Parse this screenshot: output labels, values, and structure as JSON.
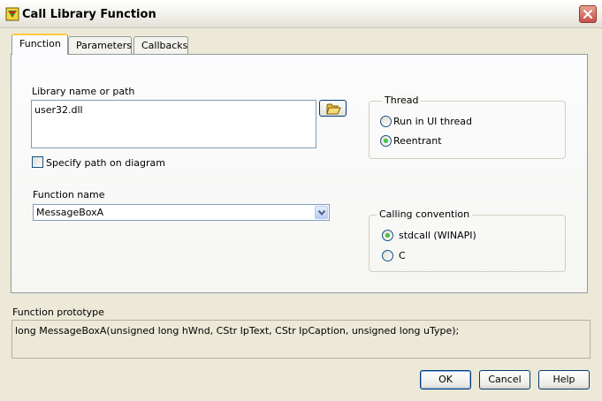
{
  "window": {
    "title": "Call Library Function"
  },
  "tabs": [
    {
      "label": "Function",
      "active": true
    },
    {
      "label": "Parameters",
      "active": false
    },
    {
      "label": "Callbacks",
      "active": false
    }
  ],
  "library": {
    "label": "Library name or path",
    "value": "user32.dll",
    "specify_path_label": "Specify path on diagram",
    "specify_path_checked": false
  },
  "function_name": {
    "label": "Function name",
    "value": "MessageBoxA"
  },
  "thread": {
    "title": "Thread",
    "options": [
      {
        "label": "Run in UI thread",
        "selected": false
      },
      {
        "label": "Reentrant",
        "selected": true
      }
    ]
  },
  "calling_convention": {
    "title": "Calling convention",
    "options": [
      {
        "label": "stdcall (WINAPI)",
        "selected": true
      },
      {
        "label": "C",
        "selected": false
      }
    ]
  },
  "prototype": {
    "label": "Function prototype",
    "value": "long MessageBoxA(unsigned long hWnd, CStr IpText, CStr IpCaption, unsigned long uType);"
  },
  "buttons": {
    "ok": "OK",
    "cancel": "Cancel",
    "help": "Help"
  },
  "colors": {
    "accent_tab": "#ffc83d",
    "radio_selected": "#21a121",
    "close_button": "#c75050"
  },
  "icons": {
    "app": "labview-icon",
    "browse": "folder-open-icon",
    "close": "close-icon",
    "dropdown": "chevron-down-icon"
  }
}
